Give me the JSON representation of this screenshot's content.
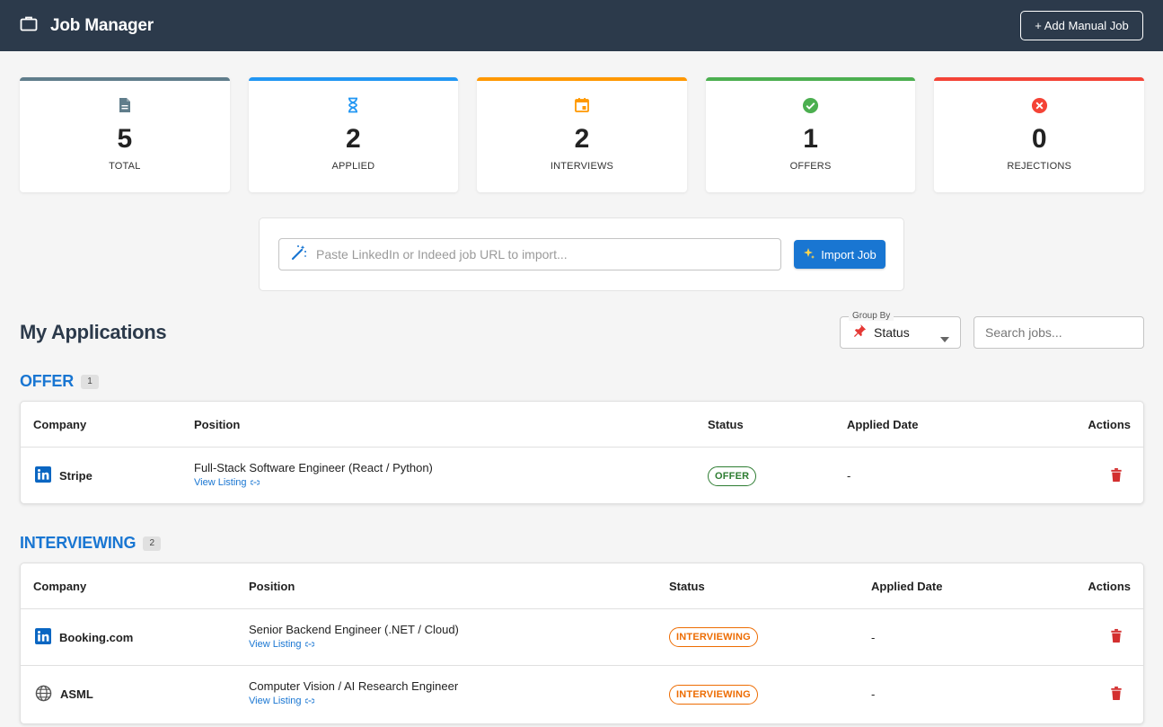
{
  "header": {
    "title": "Job Manager",
    "add_button": "+ Add Manual Job"
  },
  "stats": [
    {
      "value": "5",
      "label": "TOTAL",
      "color": "#607d8b",
      "icon": "document-icon"
    },
    {
      "value": "2",
      "label": "APPLIED",
      "color": "#2196f3",
      "icon": "hourglass-icon"
    },
    {
      "value": "2",
      "label": "INTERVIEWS",
      "color": "#ff9800",
      "icon": "calendar-icon"
    },
    {
      "value": "1",
      "label": "OFFERS",
      "color": "#4caf50",
      "icon": "check-circle-icon"
    },
    {
      "value": "0",
      "label": "REJECTIONS",
      "color": "#f44336",
      "icon": "cancel-circle-icon"
    }
  ],
  "import": {
    "placeholder": "Paste LinkedIn or Indeed job URL to import...",
    "button": "Import Job"
  },
  "applications": {
    "title": "My Applications",
    "group_by_label": "Group By",
    "group_by_value": "Status",
    "search_placeholder": "Search jobs..."
  },
  "groups": [
    {
      "name": "OFFER",
      "count": "1",
      "columns": [
        "Company",
        "Position",
        "Status",
        "Applied Date",
        "Actions"
      ],
      "rows": [
        {
          "company": "Stripe",
          "source": "linkedin",
          "position": "Full-Stack Software Engineer (React / Python)",
          "link": "View Listing",
          "status": "OFFER",
          "date": "-"
        }
      ]
    },
    {
      "name": "INTERVIEWING",
      "count": "2",
      "columns": [
        "Company",
        "Position",
        "Status",
        "Applied Date",
        "Actions"
      ],
      "rows": [
        {
          "company": "Booking.com",
          "source": "linkedin",
          "position": "Senior Backend Engineer (.NET / Cloud)",
          "link": "View Listing",
          "status": "INTERVIEWING",
          "date": "-"
        },
        {
          "company": "ASML",
          "source": "web",
          "position": "Computer Vision / AI Research Engineer",
          "link": "View Listing",
          "status": "INTERVIEWING",
          "date": "-"
        }
      ]
    }
  ]
}
